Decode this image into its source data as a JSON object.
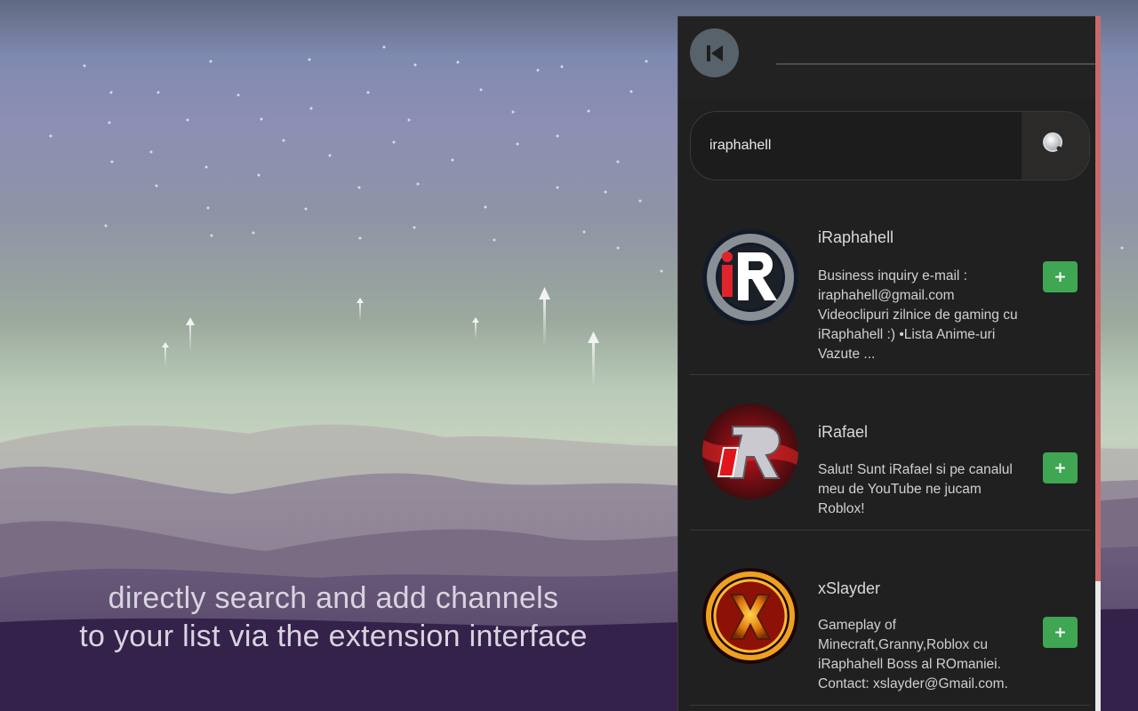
{
  "caption": {
    "line1": "directly search and add channels",
    "line2": "to your list via the extension interface"
  },
  "header": {
    "back_icon": "skip-back-icon"
  },
  "search": {
    "value": "iraphahell",
    "icon": "search-icon"
  },
  "results": [
    {
      "title": "iRaphahell",
      "description": "Business inquiry e-mail : iraphahell@gmail.com Videoclipuri zilnice de gaming cu iRaphahell :) •Lista Anime-uri Vazute ...",
      "add_label": "+"
    },
    {
      "title": "iRafael",
      "description": "Salut! Sunt iRafael si pe canalul meu de YouTube ne jucam Roblox!",
      "add_label": "+"
    },
    {
      "title": "xSlayder",
      "description": "Gameplay of Minecraft,Granny,Roblox cu iRaphahell Boss al ROmaniei. Contact: xslayder@Gmail.com.",
      "add_label": "+"
    }
  ],
  "colors": {
    "panel": "#202020",
    "add_button": "#3fa653",
    "scroll_thumb": "#c96a6a"
  }
}
